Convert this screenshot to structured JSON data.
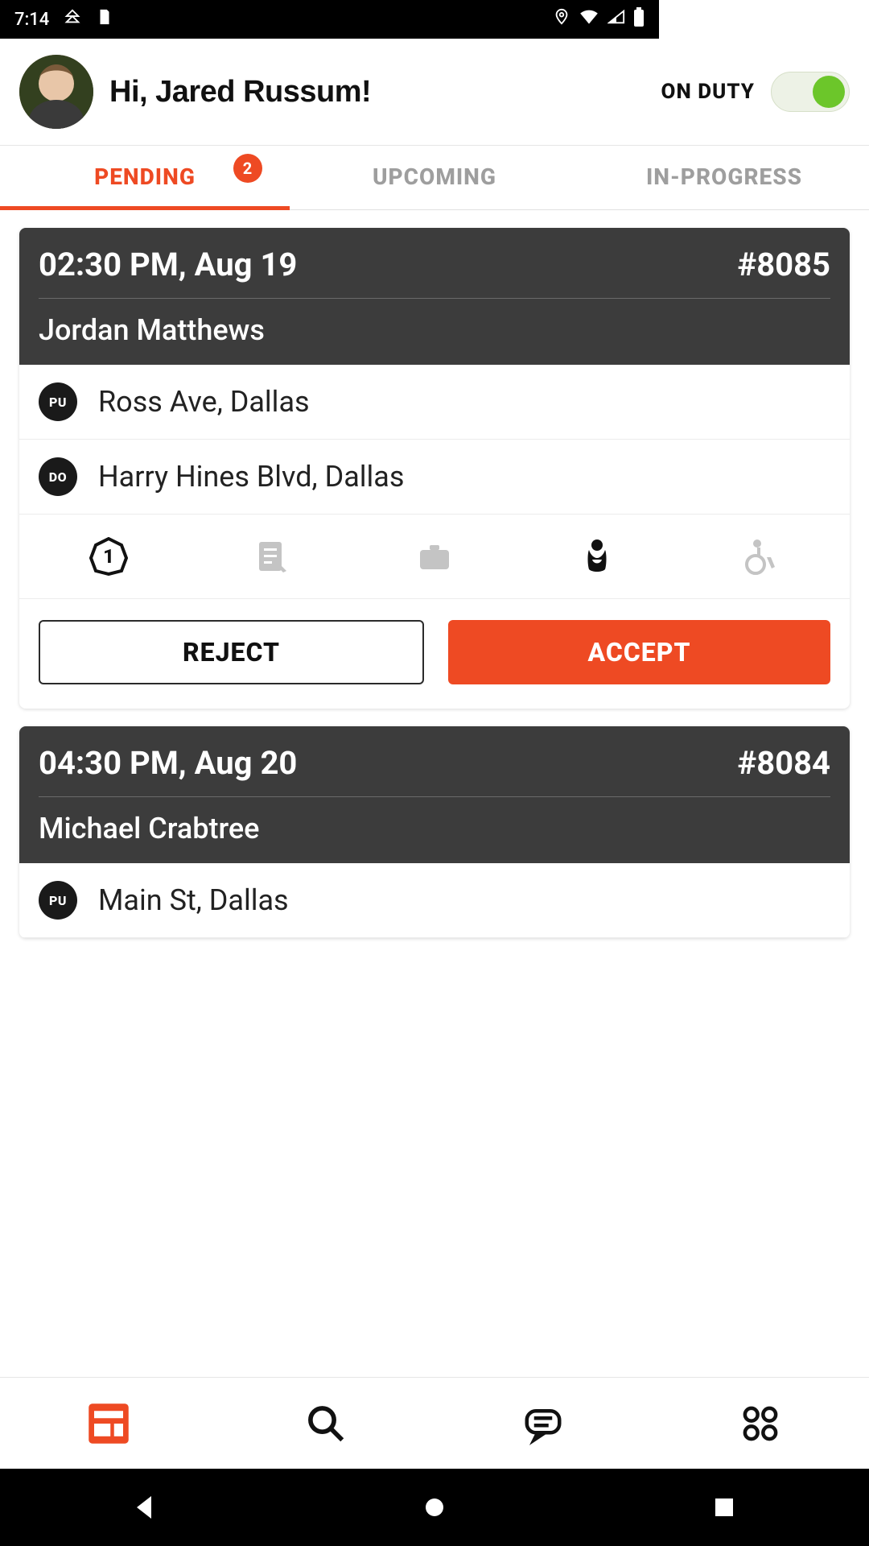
{
  "status_bar": {
    "time": "7:14"
  },
  "header": {
    "greeting": "Hi, Jared Russum!",
    "duty_label": "ON DUTY",
    "duty_on": true
  },
  "tabs": {
    "items": [
      {
        "label": "PENDING",
        "active": true,
        "badge": "2"
      },
      {
        "label": "UPCOMING",
        "active": false
      },
      {
        "label": "IN-PROGRESS",
        "active": false
      }
    ]
  },
  "cards": [
    {
      "time": "02:30 PM, Aug 19",
      "id": "#8085",
      "name": "Jordan Matthews",
      "pickup_badge": "PU",
      "pickup": "Ross Ave, Dallas",
      "dropoff_badge": "DO",
      "dropoff": "Harry Hines Blvd, Dallas",
      "reject_label": "REJECT",
      "accept_label": "ACCEPT",
      "icons": [
        "passenger-count",
        "notes",
        "luggage",
        "child-seat",
        "wheelchair"
      ]
    },
    {
      "time": "04:30 PM, Aug 20",
      "id": "#8084",
      "name": "Michael Crabtree",
      "pickup_badge": "PU",
      "pickup": "Main St, Dallas"
    }
  ],
  "colors": {
    "accent": "#ee4a23",
    "toggle_on": "#6cc62a",
    "card_header": "#3c3c3c"
  }
}
